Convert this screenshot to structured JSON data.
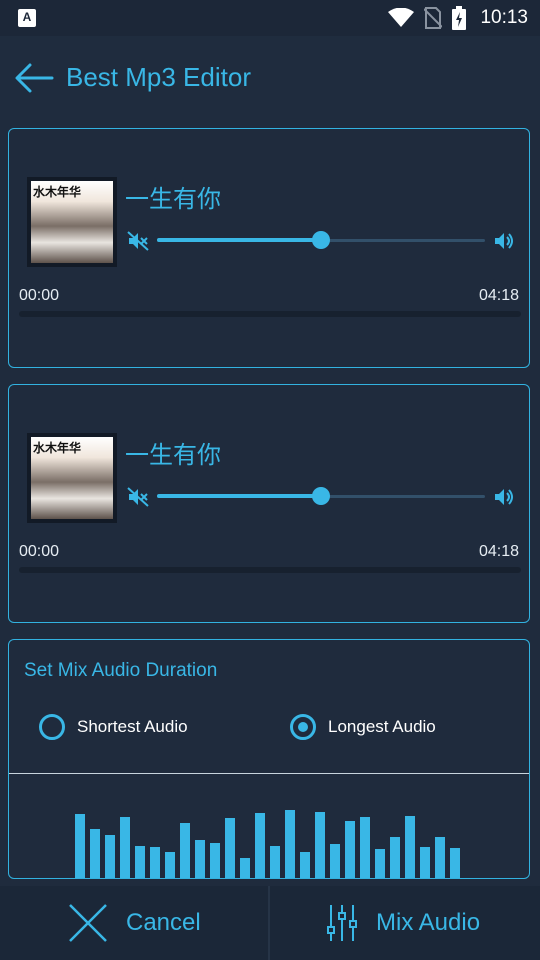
{
  "status_bar": {
    "time": "10:13",
    "left_icon_letter": "A"
  },
  "app_bar": {
    "title": "Best Mp3 Editor"
  },
  "tracks": [
    {
      "title": "一生有你",
      "volume": 0.5,
      "start_time": "00:00",
      "end_time": "04:18",
      "cover_caption": "水木年华"
    },
    {
      "title": "一生有你",
      "volume": 0.5,
      "start_time": "00:00",
      "end_time": "04:18",
      "cover_caption": "水木年华"
    }
  ],
  "mix": {
    "title": "Set Mix Audio Duration",
    "options": [
      {
        "label": "Shortest Audio",
        "selected": false
      },
      {
        "label": "Longest Audio",
        "selected": true
      }
    ],
    "visualizer_levels": [
      64,
      49,
      43,
      61,
      32,
      31,
      26,
      55,
      38,
      35,
      60,
      20,
      65,
      32,
      68,
      26,
      66,
      34,
      57,
      61,
      29,
      41,
      62,
      31,
      41,
      30
    ]
  },
  "bottom_bar": {
    "cancel_label": "Cancel",
    "mix_label": "Mix Audio"
  },
  "colors": {
    "accent": "#39b7e6",
    "background": "#1f2b3d",
    "bar_background": "#1b2738"
  }
}
